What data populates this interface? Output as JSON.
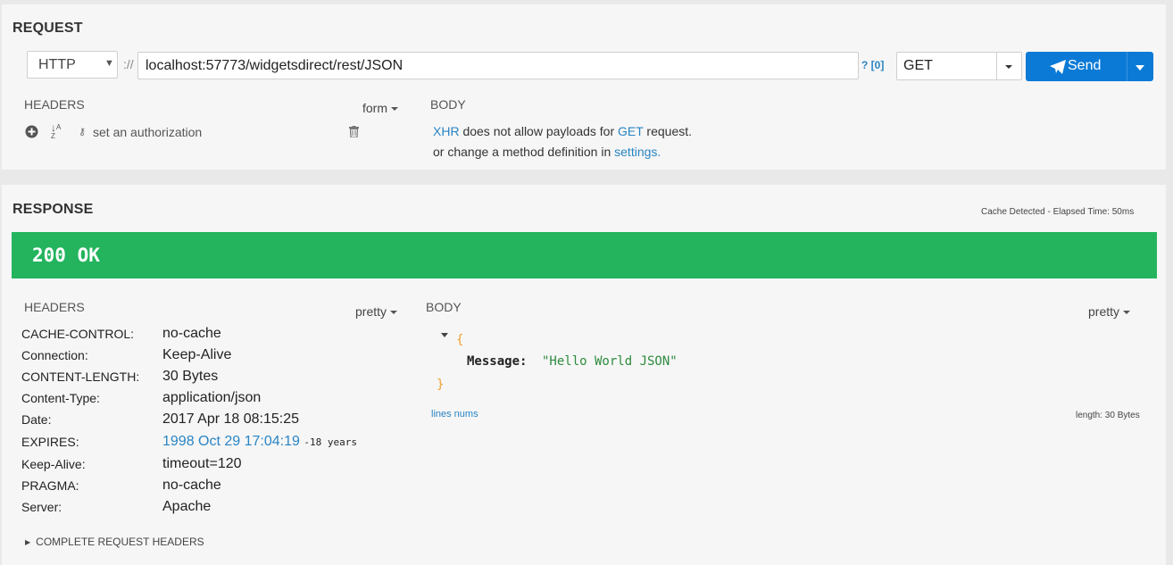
{
  "request": {
    "title": "REQUEST",
    "protocol": "HTTP",
    "separator": "://",
    "url": "localhost:57773/widgetsdirect/rest/JSON",
    "help_link": "? [0]",
    "method": "GET",
    "send_label": "Send",
    "headers_label": "HEADERS",
    "form_label": "form",
    "auth_label": "set an authorization",
    "body_label": "BODY",
    "body_msg": {
      "xhr": "XHR",
      "part1": " does not allow payloads for ",
      "get": "GET",
      "part2": " request.",
      "line2_a": "or change a method definition in ",
      "settings": "settings",
      "line2_b": "."
    }
  },
  "response": {
    "title": "RESPONSE",
    "cache_info": "Cache Detected - Elapsed Time: 50ms",
    "status": "200 OK",
    "status_color": "#23b45d",
    "headers_label": "HEADERS",
    "pretty_label": "pretty",
    "body_label": "BODY",
    "body_pretty_label": "pretty",
    "headers": [
      {
        "key": "CACHE-CONTROL:",
        "value": "no-cache"
      },
      {
        "key": "Connection:",
        "value": "Keep-Alive"
      },
      {
        "key": "CONTENT-LENGTH:",
        "value": "30 Bytes"
      },
      {
        "key": "Content-Type:",
        "value": "application/json"
      },
      {
        "key": "Date:",
        "value": "2017 Apr 18 08:15:25"
      },
      {
        "key": "EXPIRES:",
        "value": "1998 Oct 29 17:04:19",
        "extra": "-18 years"
      },
      {
        "key": "Keep-Alive:",
        "value": "timeout=120"
      },
      {
        "key": "PRAGMA:",
        "value": "no-cache"
      },
      {
        "key": "Server:",
        "value": "Apache"
      }
    ],
    "json_open": "{",
    "json_key": "Message:",
    "json_value": "\"Hello World JSON\"",
    "json_close": "}",
    "lines_nums": "lines nums",
    "length": "length: 30 Bytes",
    "complete_headers": "COMPLETE REQUEST HEADERS"
  },
  "colors": {
    "accent": "#0a7ad6",
    "link": "#2a84c4",
    "json_brace": "#f0a030",
    "json_string": "#2e8b3e"
  }
}
